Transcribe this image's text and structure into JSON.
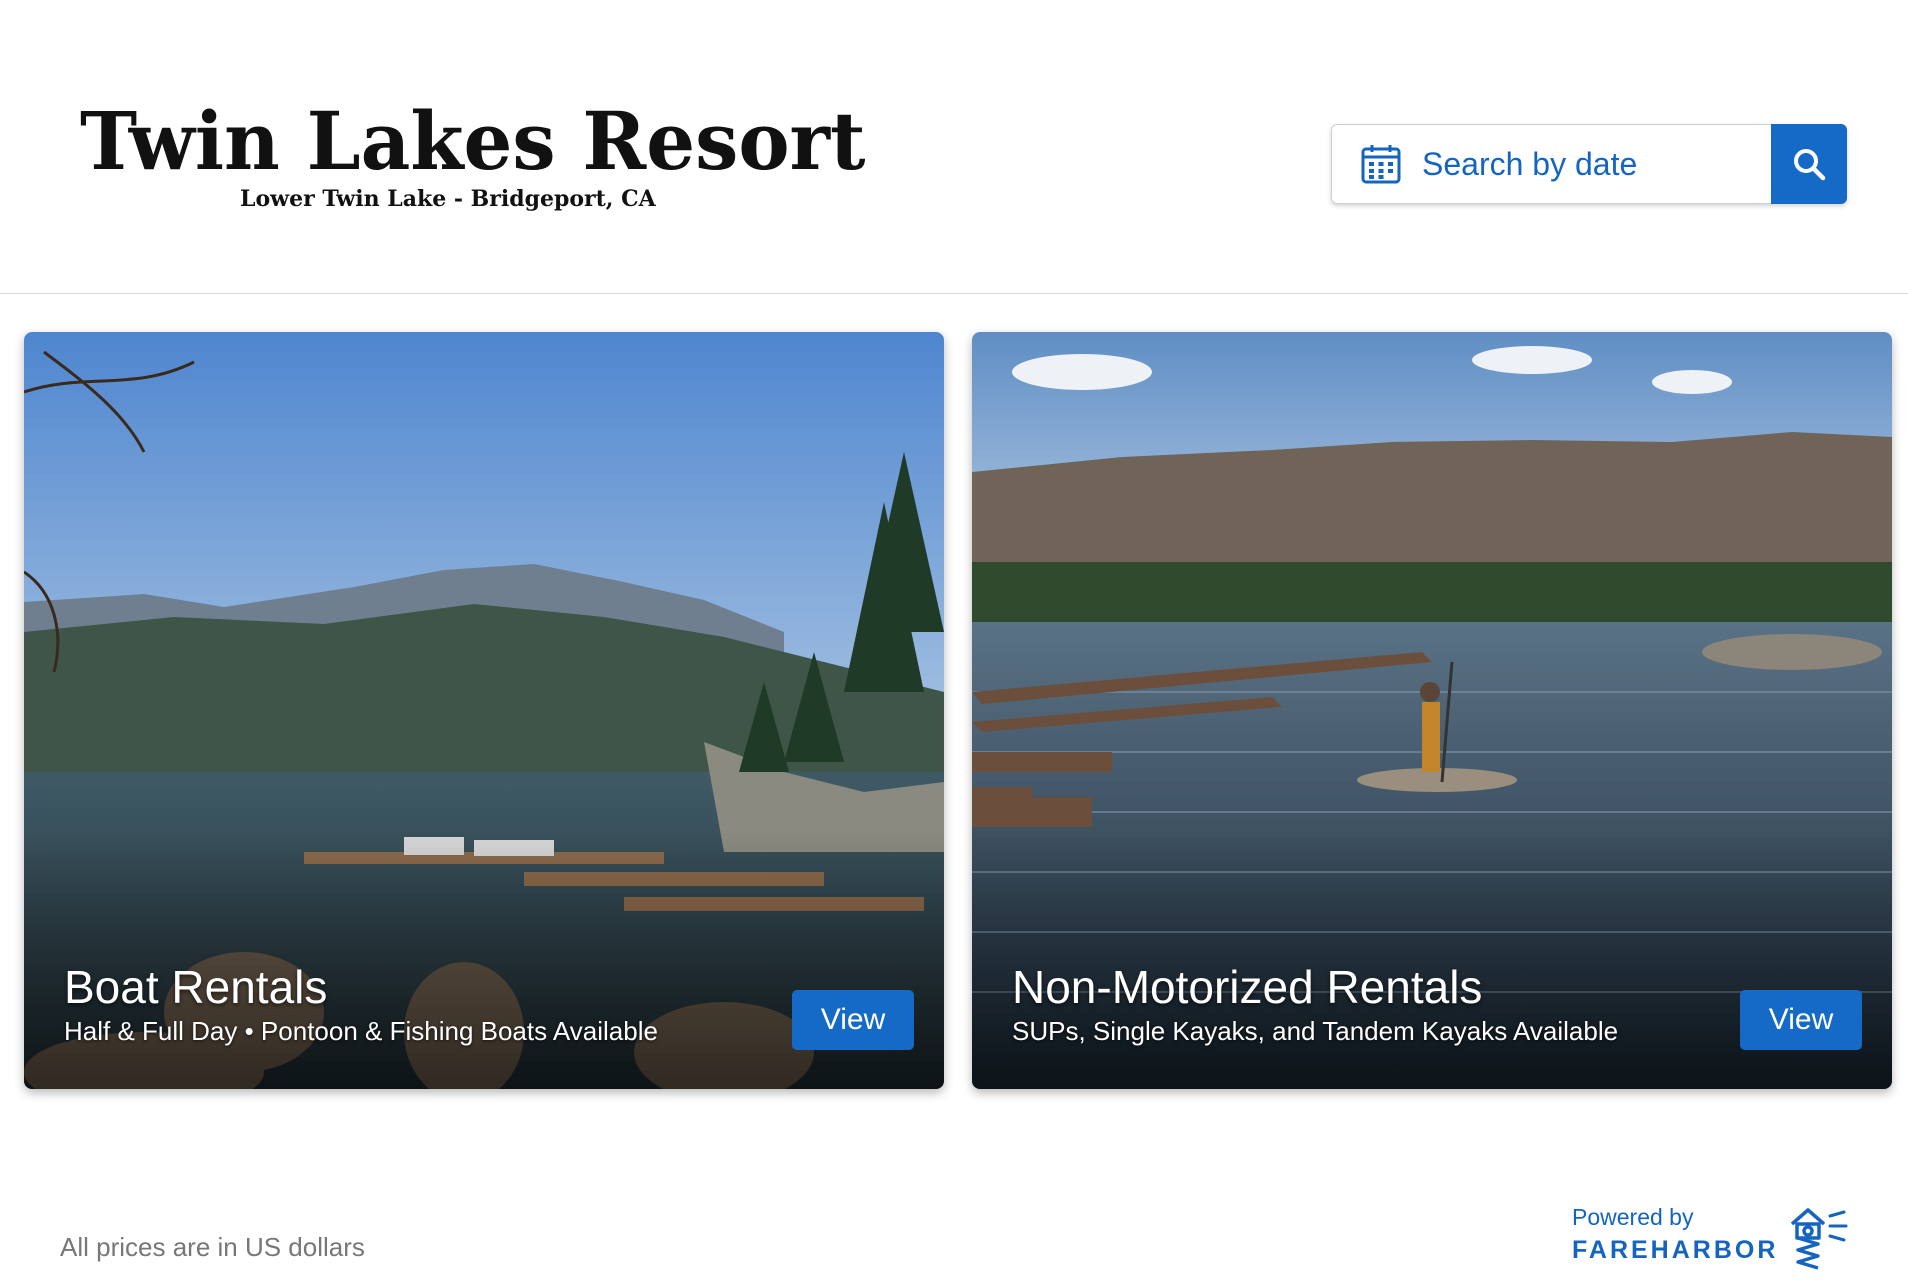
{
  "brand": {
    "title": "Twin Lakes Resort",
    "subtitle": "Lower Twin Lake - Bridgeport, CA"
  },
  "search": {
    "label": "Search by date",
    "calendar_icon": "calendar-icon",
    "button_icon": "search-icon"
  },
  "cards": [
    {
      "title": "Boat Rentals",
      "subtitle": "Half & Full Day • Pontoon & Fishing Boats Available",
      "button": "View"
    },
    {
      "title": "Non-Motorized Rentals",
      "subtitle": "SUPs, Single Kayaks, and Tandem Kayaks Available",
      "button": "View"
    }
  ],
  "footer": {
    "prices_note": "All prices are in US dollars",
    "powered_by": "Powered by",
    "provider": "FAREHARBOR",
    "provider_icon": "lighthouse-icon"
  },
  "colors": {
    "accent": "#1569c7",
    "link": "#1565c0"
  }
}
